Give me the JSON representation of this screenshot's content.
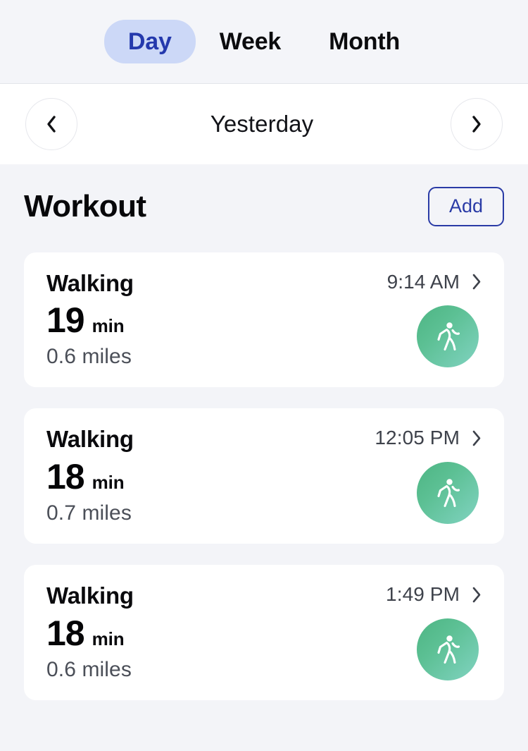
{
  "tabs": {
    "items": [
      {
        "label": "Day",
        "active": true
      },
      {
        "label": "Week",
        "active": false
      },
      {
        "label": "Month",
        "active": false
      }
    ],
    "active_bg": "#ccd8f7",
    "active_text": "#2439ad"
  },
  "date_nav": {
    "prev_icon": "chevron-left-icon",
    "next_icon": "chevron-right-icon",
    "label": "Yesterday"
  },
  "section": {
    "title": "Workout",
    "add_label": "Add",
    "accent": "#2a3ba6"
  },
  "workouts": [
    {
      "title": "Walking",
      "time": "9:14 AM",
      "duration_value": "19",
      "duration_unit": "min",
      "distance": "0.6 miles",
      "icon": "walking-icon",
      "badge_gradient_from": "#4db583",
      "badge_gradient_to": "#81d3c1"
    },
    {
      "title": "Walking",
      "time": "12:05 PM",
      "duration_value": "18",
      "duration_unit": "min",
      "distance": "0.7 miles",
      "icon": "walking-icon",
      "badge_gradient_from": "#4db583",
      "badge_gradient_to": "#81d3c1"
    },
    {
      "title": "Walking",
      "time": "1:49 PM",
      "duration_value": "18",
      "duration_unit": "min",
      "distance": "0.6 miles",
      "icon": "walking-icon",
      "badge_gradient_from": "#4db583",
      "badge_gradient_to": "#81d3c1"
    }
  ]
}
